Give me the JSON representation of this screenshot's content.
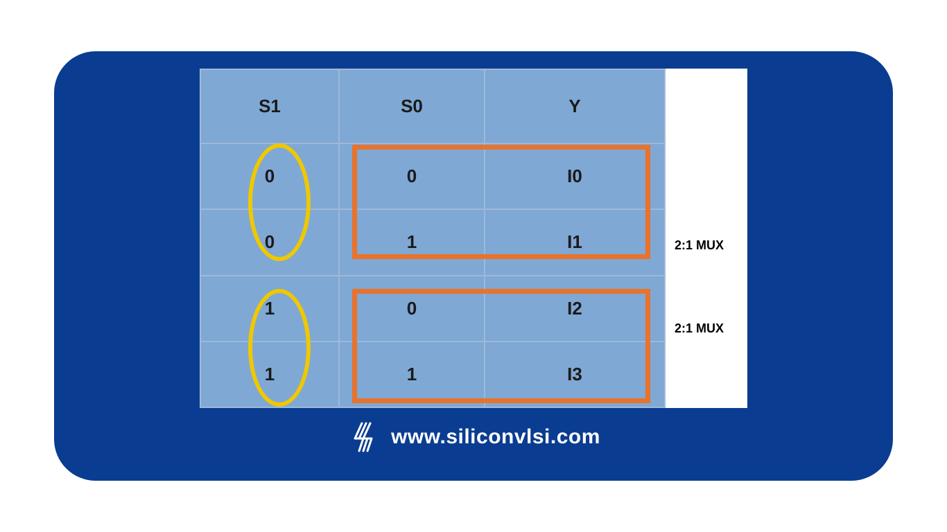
{
  "colors": {
    "card_bg": "#0a3d91",
    "cell_bg": "#7fa8d4",
    "cell_border": "#9fb9d9",
    "circle": "#f0c800",
    "box": "#e8732c"
  },
  "table": {
    "headers": {
      "s1": "S1",
      "s0": "S0",
      "y": "Y"
    },
    "rows": [
      {
        "s1": "0",
        "s0": "0",
        "y": "I0"
      },
      {
        "s1": "0",
        "s0": "1",
        "y": "I1"
      },
      {
        "s1": "1",
        "s0": "0",
        "y": "I2"
      },
      {
        "s1": "1",
        "s0": "1",
        "y": "I3"
      }
    ]
  },
  "side_labels": {
    "l1": "2:1 MUX",
    "l2": "2:1 MUX"
  },
  "footer": {
    "site": "www.siliconvlsi.com"
  }
}
